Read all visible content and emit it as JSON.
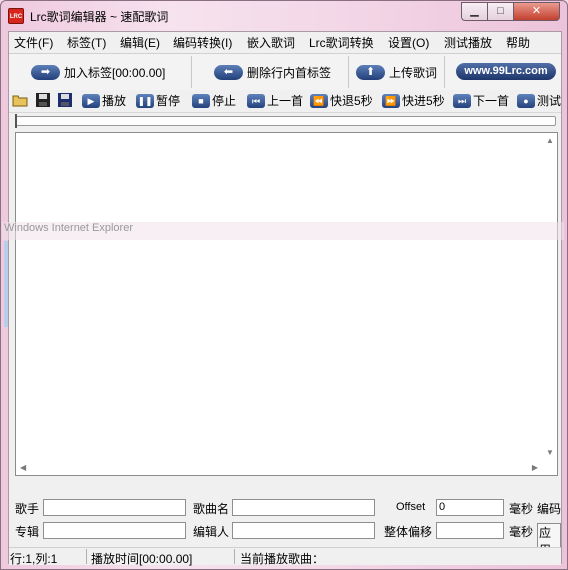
{
  "window": {
    "title": "Lrc歌词编辑器 ~ 速配歌词",
    "app_icon_text": "LRC"
  },
  "menu": [
    "文件(F)",
    "标签(T)",
    "编辑(E)",
    "编码转换(I)",
    "嵌入歌词",
    "Lrc歌词转换",
    "设置(O)",
    "测试播放",
    "帮助"
  ],
  "bigbar": {
    "add_tag": "加入标签[00:00.00]",
    "delete_tag": "删除行内首标签",
    "upload": "上传歌词",
    "site": "www.99Lrc.com"
  },
  "toolbar": {
    "play": "播放",
    "pause": "暂停",
    "stop": "停止",
    "prev": "上一首",
    "rewind": "快退5秒",
    "forward": "快进5秒",
    "next": "下一首",
    "test": "测试"
  },
  "ghost_text": "Windows Internet Explorer",
  "fields": {
    "artist_label": "歌手",
    "title_label": "歌曲名",
    "offset_label": "Offset",
    "offset_value": "0",
    "ms_label": "毫秒",
    "encoding_label": "编码",
    "album_label": "专辑",
    "editor_label": "编辑人",
    "shift_label": "整体偏移",
    "ms_label2": "毫秒",
    "apply_label": "应用"
  },
  "status": {
    "position": "行:1,列:1",
    "play_time": "播放时间[00:00.00]",
    "current_song": "当前播放歌曲："
  }
}
